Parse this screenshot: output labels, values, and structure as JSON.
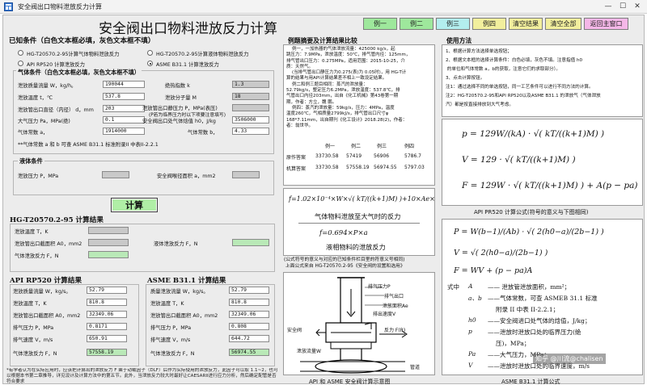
{
  "window": {
    "title": "安全阀出口物料泄放反力计算",
    "min_glyph": "—",
    "max_glyph": "☐",
    "close_glyph": "✕"
  },
  "app_title": "安全阀出口物料泄放反力计算",
  "example_buttons": [
    "例一",
    "例二",
    "例三",
    "例四",
    "清空结果",
    "清空全部",
    "返回主窗口"
  ],
  "colors": {
    "btn_green": "#9ee89c",
    "btn_cyan": "#b3eeee",
    "btn_yellow": "#f2ef9d",
    "btn_pink": "#f5b7e8",
    "calc_green": "#b0efa6",
    "green_field": "#b9e9b7"
  },
  "known": {
    "title": "已知条件（白色文本框必填，灰色文本框不填）",
    "radios": [
      "HG-T20570.2-95计算气体物料泄放反力",
      "HG-T20570.2-95计算液体物料泄放反力",
      "API RP520 计算泄放反力",
      "ASME B31.1 计算泄放反力"
    ],
    "selected_radio": 3,
    "gas_title": "气体条件（白色文本框必填，灰色文本框不填）",
    "gas_left": [
      {
        "label": "泄放质量流量 W，kg/h。",
        "value": "190044"
      },
      {
        "label": "泄放温度 t，℃",
        "value": "537.8"
      },
      {
        "label": "泄放管出口直径（内径） d，mm",
        "value": "203"
      },
      {
        "label": "大气压力 Pa，MPa(绝)",
        "value": "0.1"
      },
      {
        "label": "气体常数 a，",
        "value": "1914000"
      }
    ],
    "gas_right": [
      {
        "label": "绝热指数 k",
        "value": "1.3"
      },
      {
        "label": "泄放分子量 M",
        "value": "18"
      },
      {
        "label": "泄放管出口静压力 P，MPa(表压)",
        "value": ""
      },
      {
        "label": "安全阀出口处气体焓值 h0，J/kg",
        "value": "3506000"
      },
      {
        "label": "气体常数 b，",
        "value": "4.33"
      }
    ],
    "gas_note": "(P若为临界压力时以下项要注意填写)",
    "gas_note2": "**气体常数 a 和 b 可查 ASME B31.1 标准附录II 中表II-2.2.1",
    "liquid_title": "液体条件",
    "liquid_pressure_label": "泄放压力 P，MPa",
    "liquid_area_label": "安全阀喉径面积 a，mm2"
  },
  "calc_button": "计算",
  "hg": {
    "title": "HG-T20570.2-95 计算结果",
    "rows": [
      {
        "label": "泄放温度 T，K",
        "value": ""
      },
      {
        "label": "泄放管出口截面积 A0，mm2",
        "value": ""
      },
      {
        "label": "气体泄放反力 F，N",
        "value": ""
      }
    ],
    "liquid_label": "液体泄放反力 F，N",
    "liquid_value": ""
  },
  "api": {
    "title": "API RP520 计算结果",
    "rows": [
      {
        "label": "泄放质量流量 W，kg/s。",
        "value": "52.79"
      },
      {
        "label": "泄放温度 T，K",
        "value": "810.8"
      },
      {
        "label": "泄放管出口截面积 A0，mm2",
        "value": "32349.06"
      },
      {
        "label": "排气压力 P，MPa",
        "value": "0.8171"
      },
      {
        "label": "排气速度 V，m/s",
        "value": "650.91"
      },
      {
        "label": "气体泄放反力 F，N",
        "value": "57558.19"
      }
    ]
  },
  "asme": {
    "title": "ASME B31.1 计算结果",
    "rows": [
      {
        "label": "质量泄放流量 W，kg/s。",
        "value": "52.79"
      },
      {
        "label": "泄放温度 T，K",
        "value": "810.8"
      },
      {
        "label": "泄放管出口截面积 A0，mm2",
        "value": "32349.06"
      },
      {
        "label": "排气压力 P，MPa",
        "value": "0.808"
      },
      {
        "label": "排气速度 V，m/s",
        "value": "644.72"
      },
      {
        "label": "气体泄放反力 F，N",
        "value": "56974.55"
      }
    ]
  },
  "footnote": "*有学者认为在实际应用时，应该把计算出的泄放反力 F 乘于动载因子（DLF）后作为实际使用的泄放反力，此因子可以取 1.1~2，也可以根据本书第二章推导，详见设计及计算方法中的第五节。此外，当泄放反力较大时最好让CAESARII进行应力分析，然后确定配管是否符合要求",
  "examples": {
    "title": "例题摘要及计算结果比较",
    "text": "    例一，一加热器的气体泄放流量：425000 kg/s，起\n跳压力：7.9MPa，泄放温度：50℃，排气管内径：125mm，\n排气管出口压力：0.275MPa，适用范围：2015-10-25，介\n质：天然气。\n    (当排气管出口静压力为0.275(表)为 0.05时)，用 HG-T计\n算的结果与用API计算结果差不相上一致设定结果。\n    例二和例三题目相同：蒸汽的泄放量：\n52.79kg/s，整定压力6.2MPa，泄放温度：537.8℃，排\n气管出口内径203mm，出自《化工机械》第43卷第一期\n期，作者：方立，魏 鹏。\n    例四：蒸汽的泄放量：59kg/s，压力：4MPa，温度\n温度260℃，气相质量2799kJ/s，排气管出口尺寸φ\n168*7.11mm，出自期刊《化工设计》2018.28(2)，作者：\n者：翁世华。",
    "table_header": [
      "",
      "例一",
      "例二",
      "例三",
      "例四"
    ],
    "table_rows": [
      [
        "原作答案",
        "33730.58",
        "57419",
        "56906",
        "5786.7"
      ],
      [
        "机算答案",
        "33730.58",
        "57558.19",
        "56974.55",
        "5797.03"
      ]
    ]
  },
  "hg_formula": {
    "f1": "f=1.02×10⁻⁴×W×√( kT/((k+1)M) )+10×Ae×Pe",
    "c1": "气体物料泄放至大气时的反力",
    "f2": "f=0.694×P×a",
    "c2": "液相物料的泄放反力"
  },
  "hg_note": "(公式符号的意义与对应的已知条件栏目里的符意义号相同)\n 上面公式来自 HG-T20570.2-95《安全阀的设置和选用》",
  "diagram": {
    "labels": [
      "排气压力P",
      "排气出口",
      "泄放面积Ae",
      "排出速度V",
      "泄放流量W",
      "反力 F(R)",
      "安全阀",
      "管道"
    ],
    "caption": "API 和 ASME 安全阀计算示意图"
  },
  "usage": {
    "title": "使用方法",
    "text": "1、根据计算方法选择单选按钮；\n2、根据文本框的选择计算条件：白色必填，灰色不填。注意指值 h0\n 的单位和气体常数 a，b的获取，注意它们的求取部分）。\n3、点击计算按钮。\n注1：通过选择不同的单选按钮，同一工艺条件可以进行不同方法的计算。\n注2：HG-T20570.2-95和API RP520以及ASME B31.1 的泄放气（气体泄放\n汽）都是按直接排放到大气考虑。"
  },
  "api_formula": {
    "l1": "p = 129W/(kA) · √( kT/((k+1)M) )",
    "l2": "V = 129 · √( kT/((k+1)M) )",
    "l3": "F = 129W · √( kT/((k+1)M) ) + A(p − pa)",
    "caption": "API PR520 计算公式(符号的意义与下图相同)"
  },
  "asme_formula": {
    "l1": "P = W(b−1)/(Ab) · √( 2(h0−a)/(2b−1) )",
    "l2": "V = √( 2(h0−a)/(2b−1) )",
    "l3": "F = WV + (p − pa)A",
    "defs": [
      [
        "式中",
        "A",
        "—— 泄放管泄放面积，mm²；"
      ],
      [
        "",
        "a、b",
        "——气体常数，可查 ASMEB 31.1 标准"
      ],
      [
        "",
        "",
        "附录 II 中表 II-2.2.1；"
      ],
      [
        "",
        "h0",
        "——安全阀进口处气体的焓值，J/kg；"
      ],
      [
        "",
        "p",
        "——泄放时泄放口处的临界压力(绝"
      ],
      [
        "",
        "",
        "压)，MPa；"
      ],
      [
        "",
        "Pa",
        "——大气压力，MPa；"
      ],
      [
        "",
        "V",
        "——泄放时泄放口处的临界速度，m/s"
      ]
    ],
    "caption": "ASME B31.1 计算公式",
    "watermark": "知乎 @川流@chalisen"
  }
}
